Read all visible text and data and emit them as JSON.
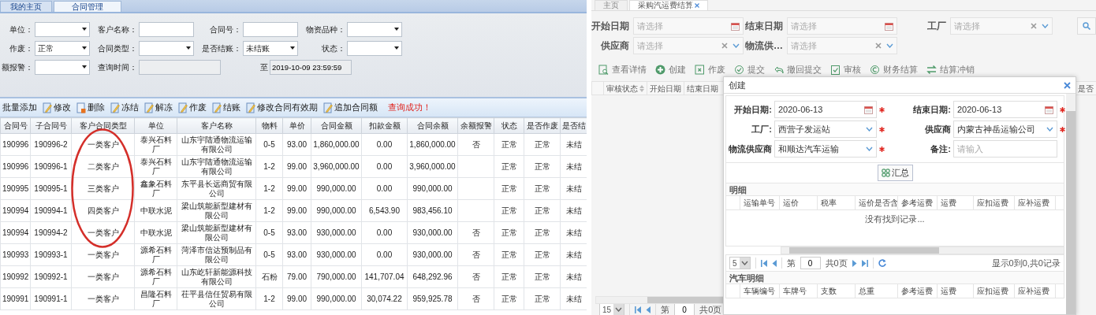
{
  "left": {
    "tabs": [
      {
        "label": "我的主页",
        "selected": false
      },
      {
        "label": "合同管理",
        "selected": true
      }
    ],
    "filter_rows": [
      [
        {
          "label": "单位：",
          "kind": "select"
        },
        {
          "label": "客户名称：",
          "kind": "text"
        },
        {
          "label": "合同号：",
          "kind": "text"
        },
        {
          "label": "物资品种：",
          "kind": "select"
        }
      ],
      [
        {
          "label": "作废：",
          "kind": "select",
          "value": "正常"
        },
        {
          "label": "合同类型：",
          "kind": "select"
        },
        {
          "label": "是否结账：",
          "kind": "select",
          "value": "未结账"
        },
        {
          "label": "状态：",
          "kind": "select"
        }
      ],
      [
        {
          "label": "额报警：",
          "kind": "select"
        },
        {
          "label": "查询时间：",
          "kind": "readonly"
        },
        {
          "label": "至",
          "kind": "readonly",
          "value": "2019-10-09 23:59:59"
        }
      ]
    ],
    "toolbar": [
      {
        "label": "批量添加",
        "kind": "text"
      },
      {
        "label": "修改",
        "kind": "edit"
      },
      {
        "label": "删除",
        "kind": "delete"
      },
      {
        "label": "冻结",
        "kind": "edit"
      },
      {
        "label": "解冻",
        "kind": "edit"
      },
      {
        "label": "作废",
        "kind": "edit"
      },
      {
        "label": "结账",
        "kind": "edit"
      },
      {
        "label": "修改合同有效期",
        "kind": "edit"
      },
      {
        "label": "追加合同额",
        "kind": "edit"
      }
    ],
    "message": "查询成功！",
    "table": {
      "columns": [
        "合同号",
        "子合同号",
        "客户合同类型",
        "单位",
        "客户名称",
        "物料",
        "单价",
        "合同金额",
        "扣款金额",
        "合同余额",
        "余额报警",
        "状态",
        "是否作废",
        "是否结"
      ],
      "rows": [
        [
          "190996",
          "190996-2",
          "一类客户",
          "泰兴石料厂",
          "山东宇陆通物流运输有限公司",
          "0-5",
          "93.00",
          "1,860,000.00",
          "0.00",
          "1,860,000.00",
          "否",
          "正常",
          "正常",
          "未结"
        ],
        [
          "190996",
          "190996-1",
          "二类客户",
          "泰兴石料厂",
          "山东宇陆通物流运输有限公司",
          "1-2",
          "99.00",
          "3,960,000.00",
          "0.00",
          "3,960,000.00",
          null,
          "正常",
          "正常",
          "未结"
        ],
        [
          "190995",
          "190995-1",
          "三类客户",
          "鑫象石料厂",
          "东平县长远商贸有限公司",
          "1-2",
          "99.00",
          "990,000.00",
          "0.00",
          "990,000.00",
          null,
          "正常",
          "正常",
          "未结"
        ],
        [
          "190994",
          "190994-1",
          "四类客户",
          "中联水泥",
          "梁山筑能新型建材有限公司",
          "1-2",
          "99.00",
          "990,000.00",
          "6,543.90",
          "983,456.10",
          null,
          "正常",
          "正常",
          "未结"
        ],
        [
          "190994",
          "190994-2",
          "一类客户",
          "中联水泥",
          "梁山筑能新型建材有限公司",
          "0-5",
          "93.00",
          "930,000.00",
          "0.00",
          "930,000.00",
          "否",
          "正常",
          "正常",
          "未结"
        ],
        [
          "190993",
          "190993-1",
          "一类客户",
          "源希石料厂",
          "菏泽市信达预制品有限公司",
          "0-5",
          "93.00",
          "930,000.00",
          "0.00",
          "930,000.00",
          "否",
          "正常",
          "正常",
          "未结"
        ],
        [
          "190992",
          "190992-1",
          "一类客户",
          "源希石料厂",
          "山东屹轩新能源科技有限公司",
          "石粉",
          "79.00",
          "790,000.00",
          "141,707.04",
          "648,292.96",
          "否",
          "正常",
          "正常",
          "未结"
        ],
        [
          "190991",
          "190991-1",
          "一类客户",
          "昌隆石料厂",
          "茌平县信任贸易有限公司",
          "1-2",
          "99.00",
          "990,000.00",
          "30,074.22",
          "959,925.78",
          "否",
          "正常",
          "正常",
          "未结"
        ]
      ]
    },
    "annotations": [
      {
        "kind": "ellipse"
      }
    ]
  },
  "right": {
    "tabs": [
      {
        "label": "主页",
        "selected": false
      },
      {
        "label": "采购汽运费结算",
        "selected": true
      }
    ],
    "filter_rows": [
      [
        {
          "label": "开始日期",
          "kind": "date",
          "placeholder": "请选择"
        },
        {
          "label": "结束日期",
          "kind": "date",
          "placeholder": "请选择"
        },
        {
          "label": "工厂",
          "kind": "select",
          "placeholder": "请选择"
        }
      ],
      [
        {
          "label": "供应商",
          "kind": "select",
          "placeholder": "请选择"
        },
        {
          "label": "物流供…",
          "kind": "select",
          "placeholder": "请选择"
        }
      ]
    ],
    "toolbar": [
      {
        "label": "查看详情",
        "kind": "details"
      },
      {
        "label": "创建",
        "kind": "add"
      },
      {
        "label": "作废",
        "kind": "void"
      },
      {
        "label": "提交",
        "kind": "submit"
      },
      {
        "label": "撤回提交",
        "kind": "undo"
      },
      {
        "label": "审核",
        "kind": "audit"
      },
      {
        "label": "财务结算",
        "kind": "finance"
      },
      {
        "label": "结算冲销",
        "kind": "swap"
      }
    ],
    "grid": {
      "columns": [
        {
          "label": "审核状态",
          "sortable": true
        },
        {
          "label": "开始日期",
          "sortable": false
        },
        {
          "label": "结束日期",
          "sortable": false
        },
        {
          "label": "是否",
          "sortable": false
        }
      ]
    },
    "pager": {
      "page_size": "15",
      "page_label": "第",
      "page": "0",
      "total": "共0页"
    },
    "dialog": {
      "title": "创建",
      "form": [
        {
          "label": "开始日期:",
          "kind": "date",
          "value": "2020-06-13",
          "required": true
        },
        {
          "label": "结束日期:",
          "kind": "date",
          "value": "2020-06-13",
          "required": true
        },
        {
          "label": "工厂:",
          "kind": "select",
          "value": "西营子发运站",
          "required": true
        },
        {
          "label": "供应商",
          "kind": "select",
          "value": "内蒙古神岳运输公司",
          "required": true
        },
        {
          "label": "物流供应商",
          "kind": "select",
          "value": "和顺达汽车运输",
          "required": true
        },
        {
          "label": "备注:",
          "kind": "text",
          "placeholder": "请输入",
          "required": false
        }
      ],
      "button": "汇总",
      "sections": [
        {
          "title": "明细",
          "columns": [
            "运输单号",
            "运价",
            "税率",
            "运价是否含",
            "参考运费",
            "运费",
            "应扣运费",
            "应补运费"
          ],
          "empty_text": "没有找到记录...",
          "pager": {
            "page_size": "5",
            "page_label": "第",
            "page": "0",
            "total": "共0页",
            "summary": "显示0到0,共0记录"
          }
        },
        {
          "title": "汽车明细",
          "columns": [
            "车辆编号",
            "车牌号",
            "支数",
            "总重",
            "参考运费",
            "运费",
            "应扣运费",
            "应补运费"
          ]
        }
      ]
    }
  }
}
